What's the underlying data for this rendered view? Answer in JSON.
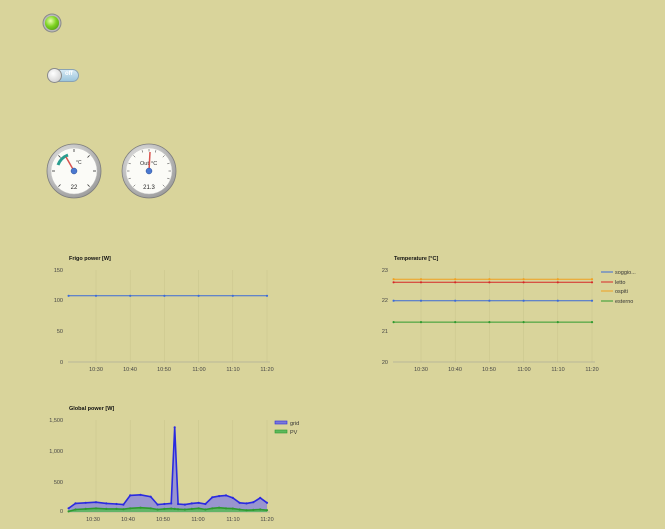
{
  "status_led": {
    "state": "on",
    "color": "#7ed321"
  },
  "switch": {
    "state_label": "off"
  },
  "gauges": [
    {
      "unit": "°C",
      "value": "22",
      "accent": "#2a9d8f"
    },
    {
      "unit": "°C",
      "label": "Out",
      "value": "21.3",
      "accent": "#d9534f"
    }
  ],
  "charts": {
    "frigo": {
      "title": "Frigo power [W]",
      "y_ticks": [
        "150",
        "100",
        "50",
        "0"
      ],
      "x_ticks": [
        "10:30",
        "10:40",
        "10:50",
        "11:00",
        "11:10",
        "11:20"
      ]
    },
    "temperature": {
      "title": "Temperature [°C]",
      "y_ticks": [
        "23",
        "22",
        "21",
        "20"
      ],
      "x_ticks": [
        "10:30",
        "10:40",
        "10:50",
        "11:00",
        "11:10",
        "11:20"
      ],
      "legend": [
        "soggio...",
        "letto",
        "ospiti",
        "esterno"
      ]
    },
    "global": {
      "title": "Global power [W]",
      "y_ticks": [
        "1,500",
        "1,000",
        "500",
        "0"
      ],
      "x_ticks": [
        "10:30",
        "10:40",
        "10:50",
        "11:00",
        "11:10",
        "11:20"
      ],
      "legend": [
        "grid",
        "PV"
      ]
    }
  },
  "chart_data": [
    {
      "type": "line",
      "title": "Frigo power [W]",
      "x": [
        "10:22",
        "10:30",
        "10:40",
        "10:50",
        "11:00",
        "11:10",
        "11:20"
      ],
      "series": [
        {
          "values": [
            108,
            108,
            108,
            108,
            108,
            108,
            108
          ],
          "color": "#3b6ad8"
        }
      ],
      "ylim": [
        0,
        150
      ],
      "grid": true
    },
    {
      "type": "line",
      "title": "Temperature [°C]",
      "x": [
        "10:22",
        "10:30",
        "10:40",
        "10:50",
        "11:00",
        "11:10",
        "11:20"
      ],
      "series": [
        {
          "name": "soggio...",
          "values": [
            22.0,
            22.0,
            22.0,
            22.0,
            22.0,
            22.0,
            22.0
          ],
          "color": "#3b6ad8"
        },
        {
          "name": "letto",
          "values": [
            22.6,
            22.6,
            22.6,
            22.6,
            22.6,
            22.6,
            22.6
          ],
          "color": "#d62728"
        },
        {
          "name": "ospiti",
          "values": [
            22.7,
            22.7,
            22.7,
            22.7,
            22.7,
            22.7,
            22.7
          ],
          "color": "#f0a020"
        },
        {
          "name": "esterno",
          "values": [
            21.3,
            21.3,
            21.3,
            21.3,
            21.3,
            21.3,
            21.3
          ],
          "color": "#2e9a2e"
        }
      ],
      "ylim": [
        20,
        23
      ],
      "legend_position": "right",
      "grid": true
    },
    {
      "type": "area",
      "title": "Global power [W]",
      "x": [
        "10:22",
        "10:24",
        "10:27",
        "10:30",
        "10:33",
        "10:36",
        "10:38",
        "10:40",
        "10:43",
        "10:46",
        "10:48",
        "10:50",
        "10:52",
        "10:53",
        "10:54",
        "10:56",
        "10:58",
        "11:00",
        "11:02",
        "11:04",
        "11:06",
        "11:08",
        "11:10",
        "11:12",
        "11:14",
        "11:16",
        "11:18",
        "11:20"
      ],
      "series": [
        {
          "name": "grid",
          "values": [
            60,
            140,
            150,
            160,
            140,
            130,
            120,
            270,
            280,
            250,
            120,
            130,
            140,
            1380,
            130,
            120,
            140,
            150,
            130,
            240,
            260,
            270,
            230,
            150,
            140,
            160,
            230,
            150
          ],
          "color": "#2a2ae0"
        },
        {
          "name": "PV",
          "values": [
            10,
            40,
            50,
            60,
            50,
            50,
            45,
            60,
            70,
            60,
            40,
            50,
            55,
            50,
            45,
            40,
            50,
            60,
            40,
            60,
            70,
            60,
            55,
            40,
            30,
            35,
            40,
            30
          ],
          "color": "#2e9a2e"
        }
      ],
      "ylim": [
        0,
        1500
      ],
      "legend_position": "top-right",
      "grid": true
    }
  ]
}
